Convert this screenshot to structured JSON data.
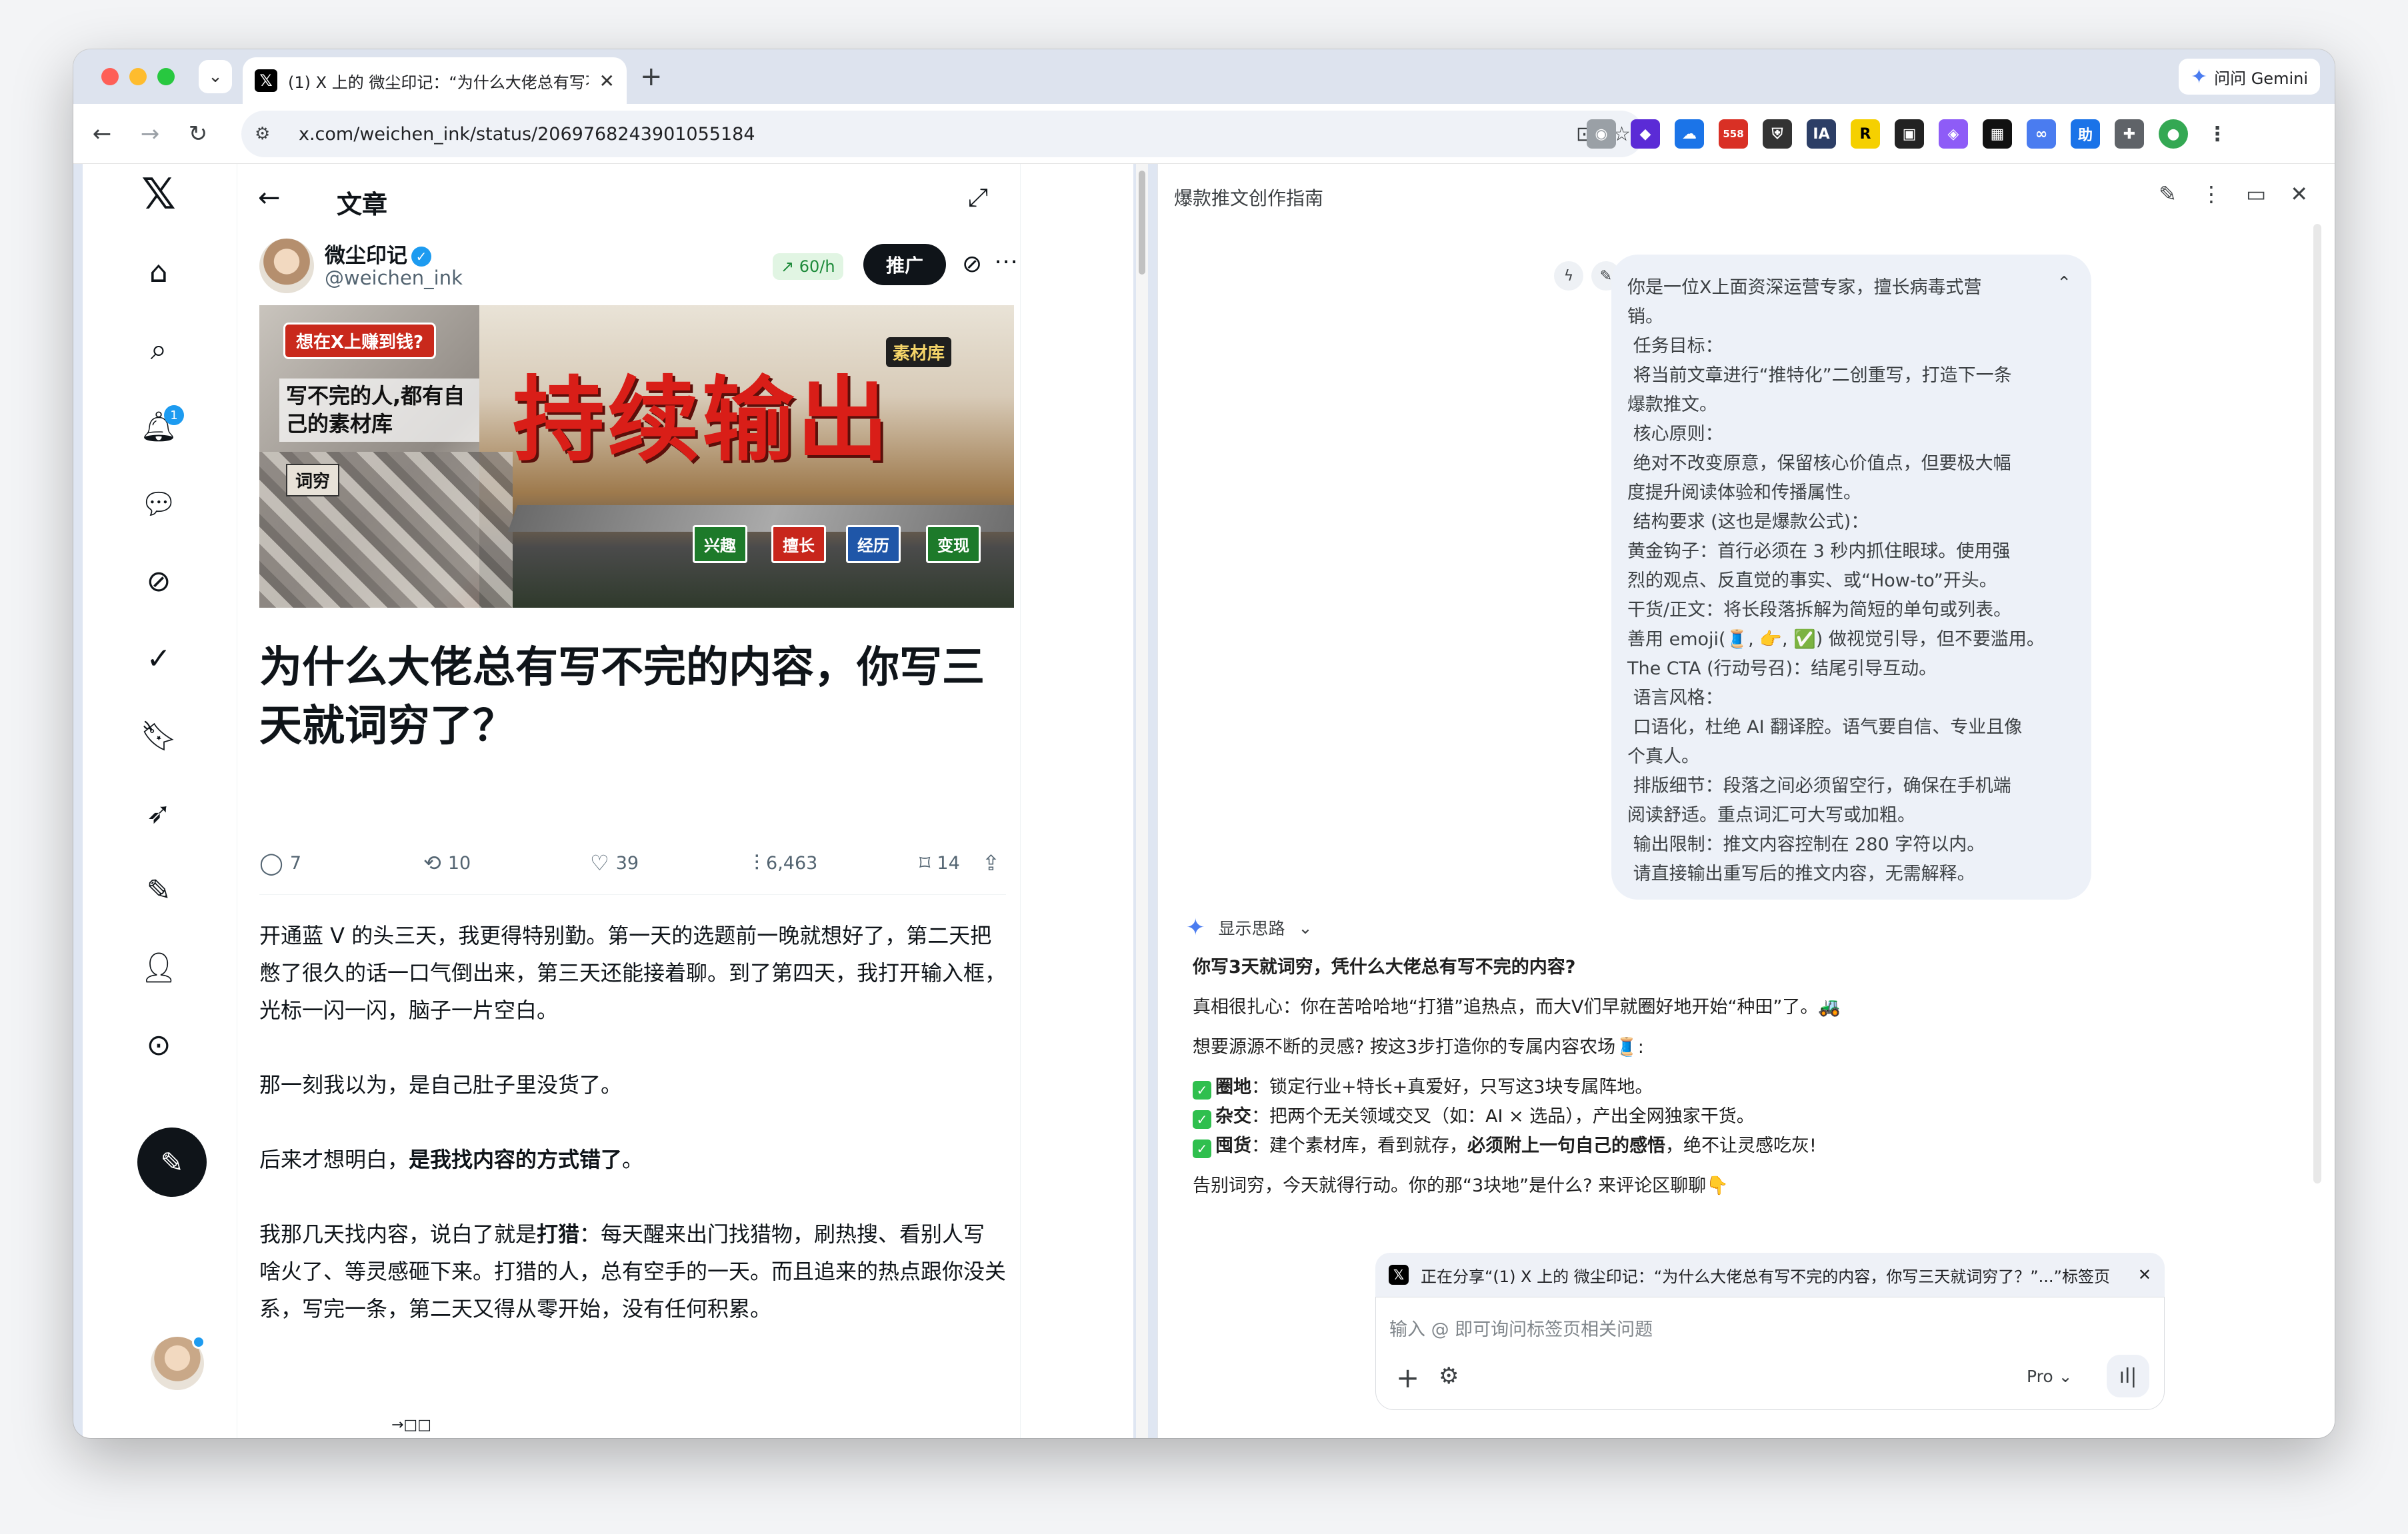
{
  "browser": {
    "tab_title": "(1) X 上的 微尘印记：“为什么大佬总有写不完的内容，你写三天就词穷了？”",
    "tab_close": "✕",
    "new_tab": "+",
    "gemini_button": "问问 Gemini",
    "url": "x.com/weichen_ink/status/2069768243901055184",
    "extension_badge": "558"
  },
  "sidebar": {
    "notification_count": "1"
  },
  "article": {
    "header_title": "文章",
    "author_name": "微尘印记",
    "author_handle": "@weichen_ink",
    "rate_badge": "↗ 60/h",
    "promote_label": "推广",
    "hero": {
      "tag": "想在X上赚到钱?",
      "subtitle": "写不完的人,都有自己的素材库",
      "stamp": "词穷",
      "big_text": "持续输出",
      "library": "素材库",
      "chips": [
        "兴趣",
        "擅长",
        "经历",
        "变现"
      ]
    },
    "title": "为什么大佬总有写不完的内容，你写三天就词穷了？",
    "stats": {
      "replies": "7",
      "reposts": "10",
      "likes": "39",
      "views": "6,463",
      "bookmarks": "14"
    },
    "paragraphs": [
      "开通蓝 V 的头三天，我更得特别勤。第一天的选题前一晚就想好了，第二天把憋了很久的话一口气倒出来，第三天还能接着聊。到了第四天，我打开输入框，光标一闪一闪，脑子一片空白。",
      "那一刻我以为，是自己肚子里没货了。"
    ],
    "p3_pre": "后来才想明白，",
    "p3_bold": "是我找内容的方式错了",
    "p3_post": "。",
    "p4_pre": "我那几天找内容，说白了就是",
    "p4_bold": "打猎",
    "p4_post": "：每天醒来出门找猎物，刷热搜、看别人写啥火了、等灵感砸下来。打猎的人，总有空手的一天。而且追来的热点跟你没关系，写完一条，第二天又得从零开始，没有任何积累。",
    "cutoff": "→□□"
  },
  "panel": {
    "title": "爆款推文创作指南",
    "prompt_lines": [
      "你是一位X上面资深运营专家，擅长病毒式营",
      "销。",
      " 任务目标：",
      " 将当前文章进行“推特化”二创重写，打造下一条",
      "爆款推文。",
      " 核心原则：",
      " 绝对不改变原意，保留核心价值点，但要极大幅",
      "度提升阅读体验和传播属性。",
      " 结构要求 (这也是爆款公式)：",
      "黄金钩子：首行必须在 3 秒内抓住眼球。使用强",
      "烈的观点、反直觉的事实、或“How-to”开头。",
      "干货/正文：将长段落拆解为简短的单句或列表。",
      "善用 emoji(🧵, 👉, ✅) 做视觉引导，但不要滥用。",
      "The CTA (行动号召)：结尾引导互动。",
      " 语言风格：",
      " 口语化，杜绝 AI 翻译腔。语气要自信、专业且像",
      "个真人。",
      " 排版细节：段落之间必须留空行，确保在手机端",
      "阅读舒适。重点词汇可大写或加粗。",
      " 输出限制：推文内容控制在 280 字符以内。",
      " 请直接输出重写后的推文内容，无需解释。"
    ],
    "thinking_label": "显示思路",
    "response": {
      "headline": "你写3天就词穷，凭什么大佬总有写不完的内容?",
      "line1": "真相很扎心：你在苦哈哈地“打猎”追热点，而大V们早就圈好地开始“种田”了。🚜",
      "line2": "想要源源不断的灵感? 按这3步打造你的专属内容农场🧵:",
      "item1_bold": "圈地",
      "item1_text": "：锁定行业+特长+真爱好，只写这3块专属阵地。",
      "item2_bold": "杂交",
      "item2_text": "：把两个无关领域交叉（如：AI × 选品），产出全网独家干货。",
      "item3_bold": "囤货",
      "item3_text_a": "：建个素材库，看到就存，",
      "item3_text_bold": "必须附上一句自己的感悟",
      "item3_text_b": "，绝不让灵感吃灰!",
      "closing": "告别词穷，今天就得行动。你的那“3块地”是什么? 来评论区聊聊👇"
    },
    "share_text": "正在分享“(1) X 上的 微尘印记：“为什么大佬总有写不完的内容，你写三天就词穷了？”...”标签页",
    "input_placeholder": "输入 @ 即可询问标签页相关问题",
    "mode": "Pro"
  },
  "colors": {
    "x_blue": "#1d9bf0",
    "x_black": "#0f1419",
    "gemini_blue": "#4a7cf0",
    "check_green": "#2fbf4e"
  }
}
